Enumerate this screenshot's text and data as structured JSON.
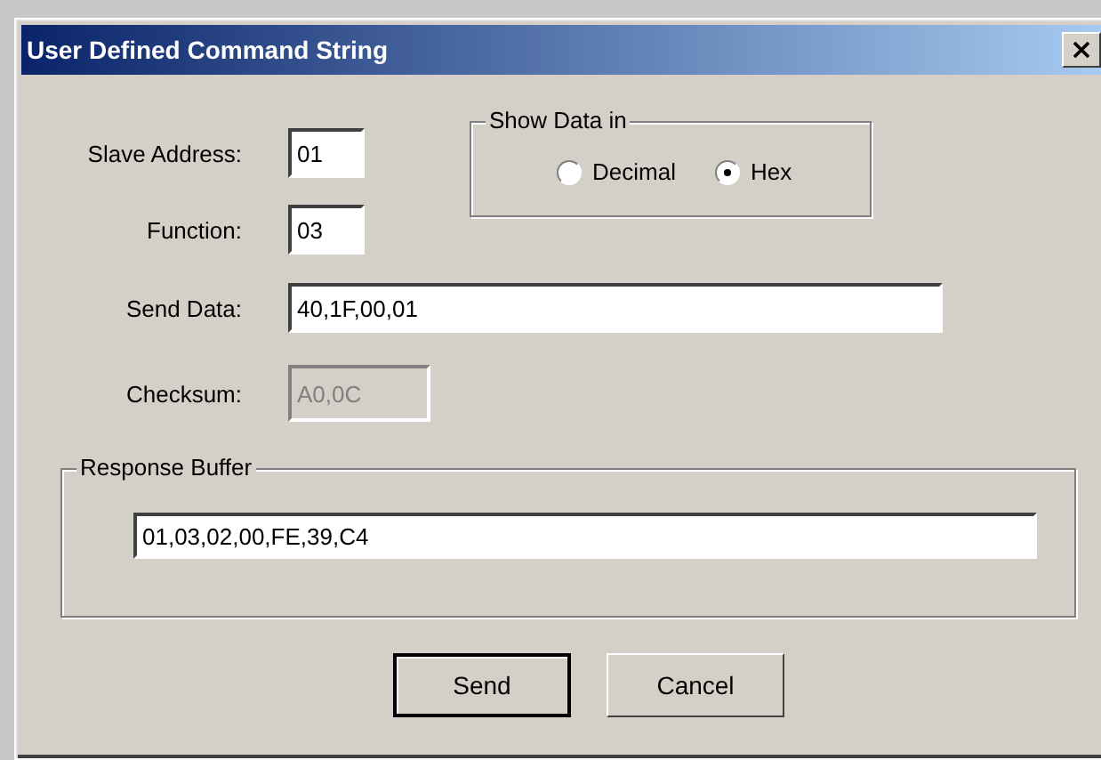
{
  "window": {
    "title": "User Defined Command String"
  },
  "fields": [
    {
      "label": "Slave Address:",
      "value": "01",
      "kind": "short",
      "disabled": false
    },
    {
      "label": "Function:",
      "value": "03",
      "kind": "short",
      "disabled": false
    },
    {
      "label": "Send Data:",
      "value": "40,1F,00,01",
      "kind": "long",
      "disabled": false
    },
    {
      "label": "Checksum:",
      "value": "A0,0C",
      "kind": "medium",
      "disabled": true
    }
  ],
  "show_data": {
    "legend": "Show Data in",
    "options": [
      {
        "label": "Decimal",
        "selected": false
      },
      {
        "label": "Hex",
        "selected": true
      }
    ]
  },
  "response_buffer": {
    "legend": "Response Buffer",
    "value": "01,03,02,00,FE,39,C4"
  },
  "buttons": [
    {
      "label": "Send",
      "default": true
    },
    {
      "label": "Cancel",
      "default": false
    }
  ]
}
